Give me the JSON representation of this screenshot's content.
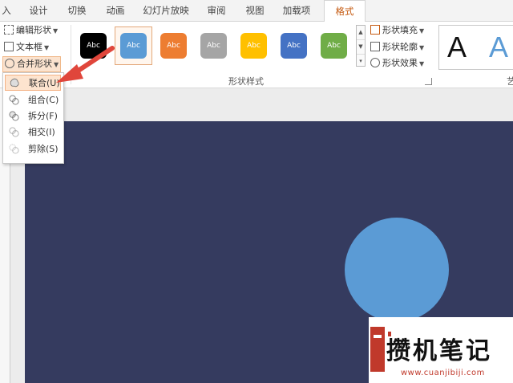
{
  "tabs": [
    {
      "label": "入"
    },
    {
      "label": "设计"
    },
    {
      "label": "切换"
    },
    {
      "label": "动画"
    },
    {
      "label": "幻灯片放映"
    },
    {
      "label": "审阅"
    },
    {
      "label": "视图"
    },
    {
      "label": "加载项"
    },
    {
      "label": "格式",
      "active": true
    }
  ],
  "insert_shapes": {
    "edit_shape": "编辑形状",
    "text_box": "文本框",
    "merge_shapes": "合并形状"
  },
  "shape_styles": {
    "swatches": [
      {
        "label": "Abc",
        "color": "#000000"
      },
      {
        "label": "Abc",
        "color": "#5b9bd5",
        "selected": true
      },
      {
        "label": "Abc",
        "color": "#ed7d31"
      },
      {
        "label": "Abc",
        "color": "#a5a5a5"
      },
      {
        "label": "Abc",
        "color": "#ffc000"
      },
      {
        "label": "Abc",
        "color": "#4472c4"
      },
      {
        "label": "Abc",
        "color": "#70ad47"
      }
    ],
    "fill": "形状填充",
    "outline": "形状轮廓",
    "effects": "形状效果",
    "group_label": "形状样式"
  },
  "wordart": {
    "sample_black": "A",
    "sample_blue": "A",
    "group_label_partial": "艺"
  },
  "merge_menu": {
    "items": [
      {
        "label": "联合(U)",
        "active": true
      },
      {
        "label": "组合(C)"
      },
      {
        "label": "拆分(F)"
      },
      {
        "label": "相交(I)"
      },
      {
        "label": "剪除(S)"
      }
    ]
  },
  "colors": {
    "slide_bg": "#353b5f",
    "circle": "#5b9bd5",
    "accent": "#c55a11",
    "arrow": "#e0463b"
  },
  "watermark": {
    "text": "攒机笔记",
    "url": "www.cuanjibiji.com"
  }
}
